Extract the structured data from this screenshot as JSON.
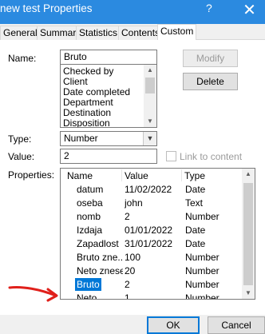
{
  "window": {
    "title": "new test Properties",
    "help": "?",
    "close": "✕"
  },
  "tabs": [
    "General",
    "Summary",
    "Statistics",
    "Contents",
    "Custom"
  ],
  "custom": {
    "name_label": "Name:",
    "name_value": "Bruto",
    "modify_label": "Modify",
    "delete_label": "Delete",
    "name_list": [
      "Checked by",
      "Client",
      "Date completed",
      "Department",
      "Destination",
      "Disposition"
    ],
    "type_label": "Type:",
    "type_value": "Number",
    "value_label": "Value:",
    "value_value": "2",
    "link_label": "Link to content",
    "properties_label": "Properties:",
    "columns": [
      "Name",
      "Value",
      "Type"
    ],
    "rows": [
      {
        "name": "datum",
        "value": "11/02/2022",
        "type": "Date"
      },
      {
        "name": "oseba",
        "value": "john",
        "type": "Text"
      },
      {
        "name": "nomb",
        "value": "2",
        "type": "Number"
      },
      {
        "name": "Izdaja",
        "value": "01/01/2022",
        "type": "Date"
      },
      {
        "name": "Zapadlost",
        "value": "31/01/2022",
        "type": "Date"
      },
      {
        "name": "Bruto zne...",
        "value": "100",
        "type": "Number"
      },
      {
        "name": "Neto znesek",
        "value": "20",
        "type": "Number"
      },
      {
        "name": "Bruto",
        "value": "2",
        "type": "Number"
      },
      {
        "name": "Neto",
        "value": "1",
        "type": "Number"
      }
    ],
    "selected_row": 7
  },
  "footer": {
    "ok_label": "OK",
    "cancel_label": "Cancel"
  },
  "colors": {
    "titlebar": "#2b8ae0",
    "selection": "#0078d7",
    "annotation": "#e0201b"
  }
}
